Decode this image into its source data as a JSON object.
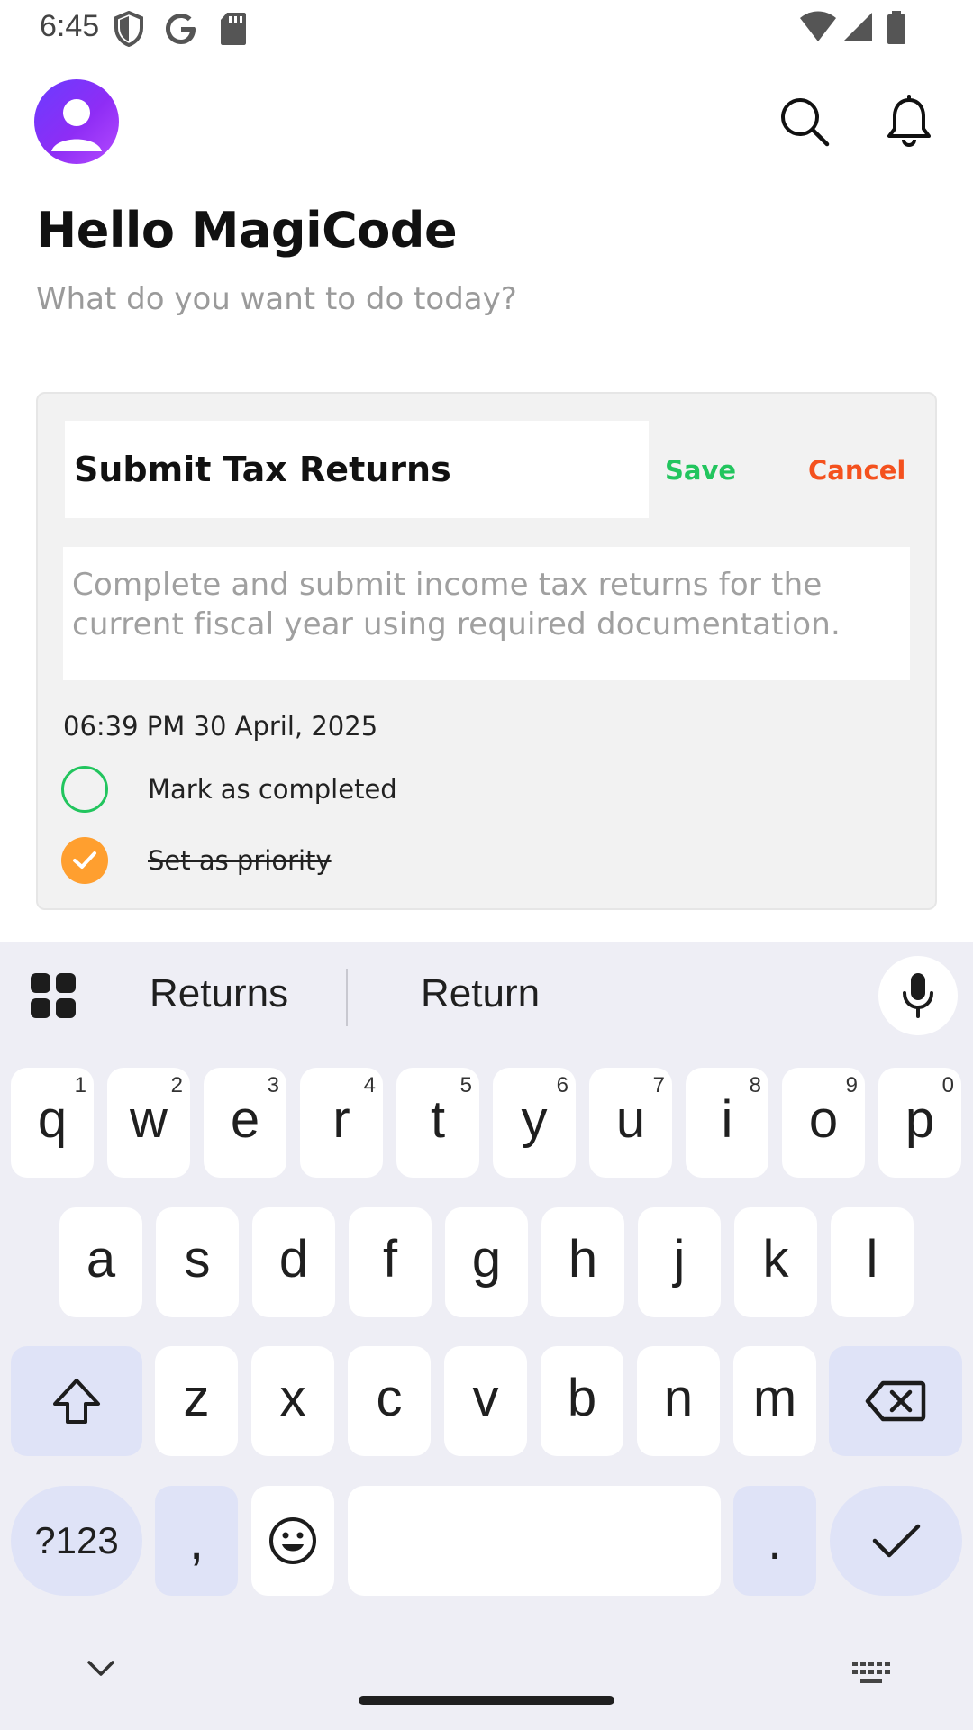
{
  "status_bar": {
    "time": "6:45",
    "icons": [
      "shield-icon",
      "google-icon",
      "sd-card-icon",
      "wifi-icon",
      "signal-icon",
      "battery-icon"
    ]
  },
  "header": {
    "avatar": "user-avatar",
    "actions": [
      "search-icon",
      "bell-icon"
    ]
  },
  "greeting": {
    "title": "Hello MagiCode",
    "subtitle": "What do you want to do today?"
  },
  "task_card": {
    "title_value": "Submit Tax Returns",
    "save_label": "Save",
    "cancel_label": "Cancel",
    "description_value": "Complete and submit income tax returns for the current fiscal year using required documentation.",
    "datetime": "06:39 PM 30 April, 2025",
    "mark_completed_label": "Mark as completed",
    "mark_completed_checked": false,
    "priority_label": "Set as priority",
    "priority_checked": true,
    "colors": {
      "save": "#22c55e",
      "cancel": "#f4511e",
      "priority": "#ff9f2f"
    }
  },
  "keyboard": {
    "suggestions": [
      "Returns",
      "Return"
    ],
    "row1": [
      {
        "key": "q",
        "hint": "1"
      },
      {
        "key": "w",
        "hint": "2"
      },
      {
        "key": "e",
        "hint": "3"
      },
      {
        "key": "r",
        "hint": "4"
      },
      {
        "key": "t",
        "hint": "5"
      },
      {
        "key": "y",
        "hint": "6"
      },
      {
        "key": "u",
        "hint": "7"
      },
      {
        "key": "i",
        "hint": "8"
      },
      {
        "key": "o",
        "hint": "9"
      },
      {
        "key": "p",
        "hint": "0"
      }
    ],
    "row2": [
      "a",
      "s",
      "d",
      "f",
      "g",
      "h",
      "j",
      "k",
      "l"
    ],
    "row3": [
      "z",
      "x",
      "c",
      "v",
      "b",
      "n",
      "m"
    ],
    "symbols_label": "?123",
    "comma_label": ",",
    "period_label": "."
  }
}
